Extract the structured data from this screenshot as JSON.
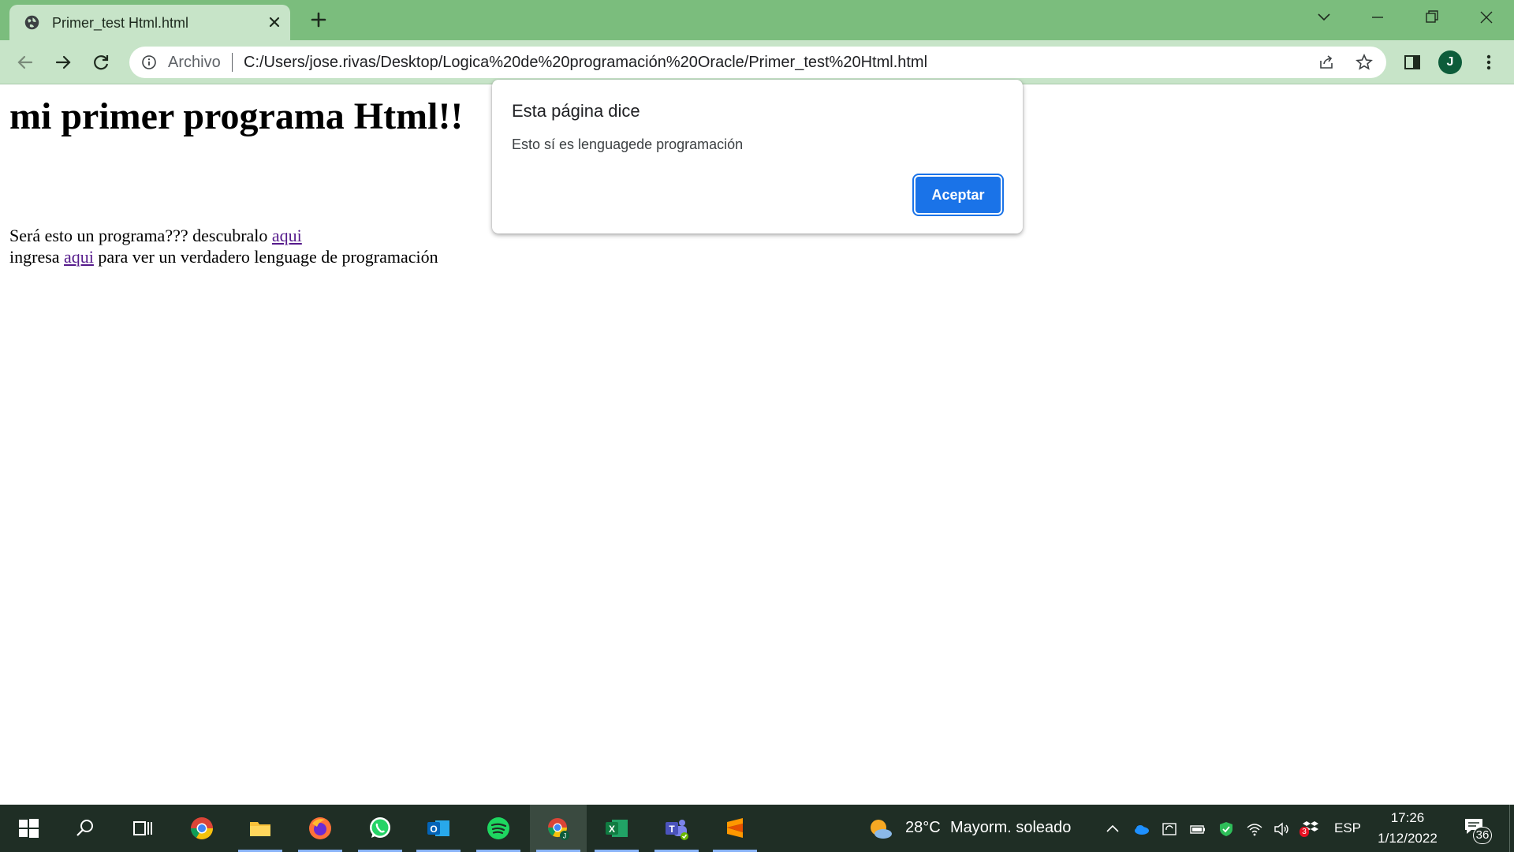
{
  "browser": {
    "tab_title": "Primer_test Html.html",
    "scheme_label": "Archivo",
    "url": "C:/Users/jose.rivas/Desktop/Logica%20de%20programación%20Oracle/Primer_test%20Html.html",
    "profile_initial": "J",
    "theme_color": "#7bbd7d"
  },
  "page": {
    "heading": "mi primer programa Html!!",
    "line1_text": "Será esto un programa??? descubralo ",
    "line1_link": "aqui",
    "line2_before": "ingresa ",
    "line2_link": "aqui",
    "line2_after": " para ver un verdadero lenguage de programación"
  },
  "dialog": {
    "title": "Esta página dice",
    "message": "Esto sí es lenguagede programación",
    "ok_label": "Aceptar",
    "accent": "#1a73e8"
  },
  "taskbar": {
    "apps": [
      "start-icon",
      "search-icon",
      "task-view-icon",
      "chrome-icon",
      "file-explorer-icon",
      "firefox-icon",
      "whatsapp-icon",
      "outlook-icon",
      "spotify-icon",
      "chrome-profile-icon",
      "excel-icon",
      "teams-icon",
      "sublime-text-icon"
    ],
    "weather_temp": "28°C",
    "weather_desc": "Mayorm. soleado",
    "language": "ESP",
    "time": "17:26",
    "date": "1/12/2022",
    "notification_count": "36",
    "tray_badge": "3"
  }
}
